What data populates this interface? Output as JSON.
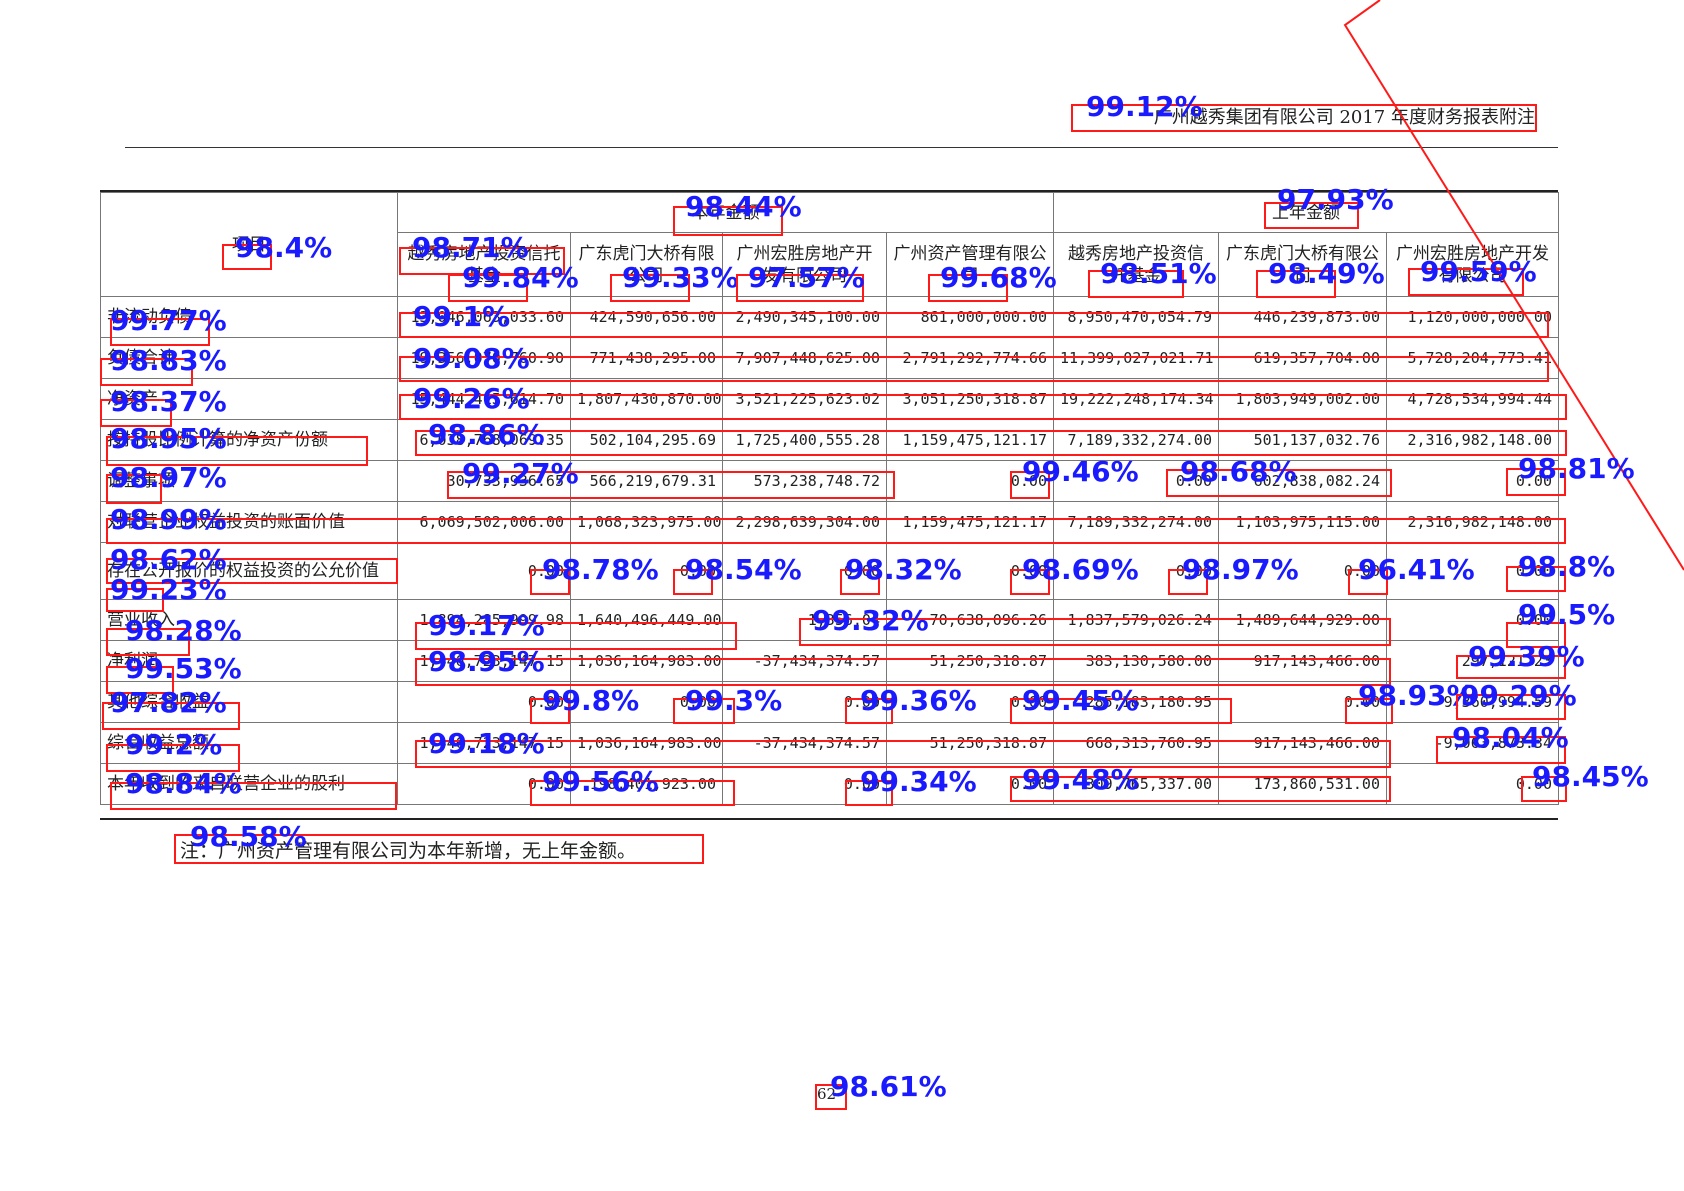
{
  "document": {
    "header": "广州越秀集团有限公司 2017 年度财务报表附注",
    "note": "注：广州资产管理有限公司为本年新增，无上年金额。",
    "page_number": "62"
  },
  "table": {
    "item_header": "项目",
    "current_group": "本年金额",
    "prior_group": "上年金额",
    "columns": [
      "越秀房地产投资信托基金",
      "广东虎门大桥有限公司",
      "广州宏胜房地产开发有限公司",
      "广州资产管理有限公司",
      "越秀房地产投资信托基金",
      "广东虎门大桥有限公司",
      "广州宏胜房地产开发有限公司"
    ],
    "rows": [
      {
        "label": "非流动负债",
        "values": [
          "13,046,063,033.60",
          "424,590,656.00",
          "2,490,345,100.00",
          "861,000,000.00",
          "8,950,470,054.79",
          "446,239,873.00",
          "1,120,000,000.00"
        ]
      },
      {
        "label": "负债合计",
        "values": [
          "19,356,070,760.90",
          "771,438,295.00",
          "7,907,448,625.00",
          "2,791,292,774.66",
          "11,399,027,021.71",
          "619,357,704.00",
          "5,728,204,773.41"
        ]
      },
      {
        "label": "净资产",
        "values": [
          "15,444,415,614.70",
          "1,807,430,870.00",
          "3,521,225,623.02",
          "3,051,250,318.87",
          "19,222,248,174.34",
          "1,803,949,002.00",
          "4,728,534,994.44"
        ]
      },
      {
        "label": "按持股比例计算的净资产份额",
        "values": [
          "6,038,768,069.35",
          "502,104,295.69",
          "1,725,400,555.28",
          "1,159,475,121.17",
          "7,189,332,274.00",
          "501,137,032.76",
          "2,316,982,148.00"
        ]
      },
      {
        "label": "调整事项",
        "values": [
          "30,733,936.65",
          "566,219,679.31",
          "573,238,748.72",
          "0.00",
          "0.00",
          "602,838,082.24",
          "0.00"
        ]
      },
      {
        "label": "对联营企业权益投资的账面价值",
        "values": [
          "6,069,502,006.00",
          "1,068,323,975.00",
          "2,298,639,304.00",
          "1,159,475,121.17",
          "7,189,332,274.00",
          "1,103,975,115.00",
          "2,316,982,148.00"
        ]
      },
      {
        "label": "存在公开报价的权益投资的公允价值",
        "values": [
          "0.00",
          "0.00",
          "0.00",
          "0.00",
          "0.00",
          "0.00",
          "0.00"
        ]
      },
      {
        "label": "营业收入",
        "values": [
          "1,894,285,999.98",
          "1,640,496,449.00",
          "1,356.04",
          "70,638,096.26",
          "1,837,579,026.24",
          "1,489,644,929.00",
          "0.00"
        ]
      },
      {
        "label": "净利润",
        "values": [
          "1,446,723,147.15",
          "1,036,164,983.00",
          "-37,434,374.57",
          "51,250,318.87",
          "383,130,580.00",
          "917,143,466.00",
          "297,121.23"
        ]
      },
      {
        "label": "其他综合收益",
        "values": [
          "0.00",
          "0.00",
          "0.00",
          "0.00",
          "285,183,180.95",
          "0.00",
          "-9,360,994.59"
        ]
      },
      {
        "label": "综合收益总额",
        "values": [
          "1,446,723,147.15",
          "1,036,164,983.00",
          "-37,434,374.57",
          "51,250,318.87",
          "668,313,760.95",
          "917,143,466.00",
          "-9,063,873.34"
        ]
      },
      {
        "label": "本年收到的来自联营企业的股利",
        "values": [
          "0.00",
          "198,401,923.00",
          "0.00",
          "0.00",
          "309,765,337.00",
          "173,860,531.00",
          "0.00"
        ]
      }
    ]
  },
  "ocr_confidences": {
    "header": "99.12%",
    "current_group": "98.44%",
    "prior_group": "97.93%",
    "item_header": "98.4%",
    "col1_a": "98.71%",
    "col1_b": "99.84%",
    "col2": "99.33%",
    "col3": "97.57%",
    "col4": "99.68%",
    "col5": "98.51%",
    "col6": "98.49%",
    "col7": "99.59%",
    "r1_label": "99.77%",
    "r1_v1": "99.1%",
    "r2_label": "98.83%",
    "r2_v1": "99.08%",
    "r3_label": "98.37%",
    "r3_v1": "99.26%",
    "r4_label": "98.95%",
    "r4_v1": "98.86%",
    "r5_label": "98.97%",
    "r5_v1": "99.27%",
    "r5_v4": "99.46%",
    "r5_v5": "98.68%",
    "r5_v7": "98.81%",
    "r6_label": "98.99%",
    "r7_label_a": "98.62%",
    "r7_label_b": "99.23%",
    "r7_v1": "98.78%",
    "r7_v2": "98.54%",
    "r7_v3": "98.32%",
    "r7_v4": "98.69%",
    "r7_v5": "98.97%",
    "r7_v6": "96.41%",
    "r7_v7": "98.8%",
    "r8_label": "98.28%",
    "r8_v1": "99.17%",
    "r8_v3": "99.32%",
    "r8_v7": "99.5%",
    "r9_label": "99.53%",
    "r9_v1": "98.95%",
    "r9_v7": "99.39%",
    "r10_label": "97.82%",
    "r10_v1": "99.8%",
    "r10_v2": "99.3%",
    "r10_v3": "99.36%",
    "r10_v4": "99.45%",
    "r10_v6": "98.93%",
    "r10_v7": "99.29%",
    "r11_label": "99.2%",
    "r11_v1": "99.18%",
    "r11_v7": "98.04%",
    "r12_label": "98.84%",
    "r12_v1": "99.56%",
    "r12_v3": "99.34%",
    "r12_v4": "99.48%",
    "r12_v7": "98.45%",
    "note": "98.58%",
    "page": "98.61%"
  },
  "colors": {
    "box": "#ff1a1a",
    "confidence_text": "#1a1aff",
    "crop_line": "#ff1a1a"
  }
}
